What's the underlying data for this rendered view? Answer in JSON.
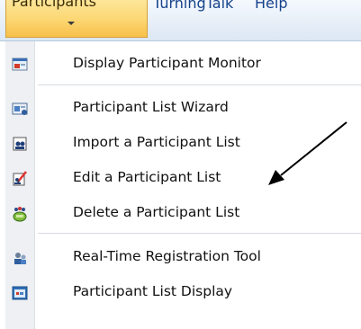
{
  "ribbon": {
    "tabs": [
      {
        "label": "Participants",
        "active": true
      },
      {
        "label": "TurningTalk",
        "active": false
      },
      {
        "label": "Help",
        "active": false
      }
    ]
  },
  "menu": {
    "items": [
      {
        "label": "Display Participant Monitor",
        "icon": "monitor-icon"
      },
      {
        "label": "Participant List Wizard",
        "icon": "wizard-icon"
      },
      {
        "label": "Import a Participant List",
        "icon": "import-list-icon"
      },
      {
        "label": "Edit a Participant List",
        "icon": "edit-list-icon"
      },
      {
        "label": "Delete a Participant List",
        "icon": "delete-list-icon"
      },
      {
        "label": "Real-Time Registration Tool",
        "icon": "registration-icon"
      },
      {
        "label": "Participant List Display",
        "icon": "list-display-icon"
      }
    ]
  },
  "colors": {
    "active_tab": "#fcd671",
    "tab_text": "#15428b",
    "menu_gutter": "#eef0f3",
    "arrow": "#000000"
  }
}
